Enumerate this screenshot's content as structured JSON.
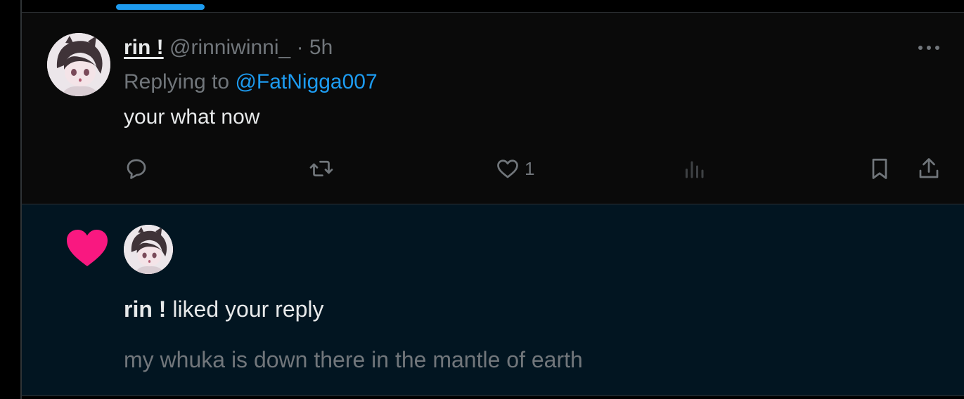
{
  "tweet": {
    "display_name": "rin !",
    "handle": "@rinniwinni_",
    "separator": "·",
    "time": "5h",
    "replying_prefix": "Replying to",
    "replying_to": "@FatNigga007",
    "text": "your what now",
    "like_count": "1"
  },
  "notification": {
    "actor_name": "rin !",
    "action_text": "liked your reply",
    "quoted_text": "my whuka is down there in the mantle of earth"
  },
  "icons": {
    "reply": "reply-icon",
    "retweet": "retweet-icon",
    "like": "heart-icon",
    "views": "analytics-icon",
    "bookmark": "bookmark-icon",
    "share": "share-icon",
    "more": "more-icon",
    "notification_like": "heart-filled-icon"
  },
  "colors": {
    "accent": "#1d9bf0",
    "like_pink": "#f91880",
    "muted": "#71767b",
    "text": "#e7e9ea",
    "notification_bg": "#021521"
  }
}
